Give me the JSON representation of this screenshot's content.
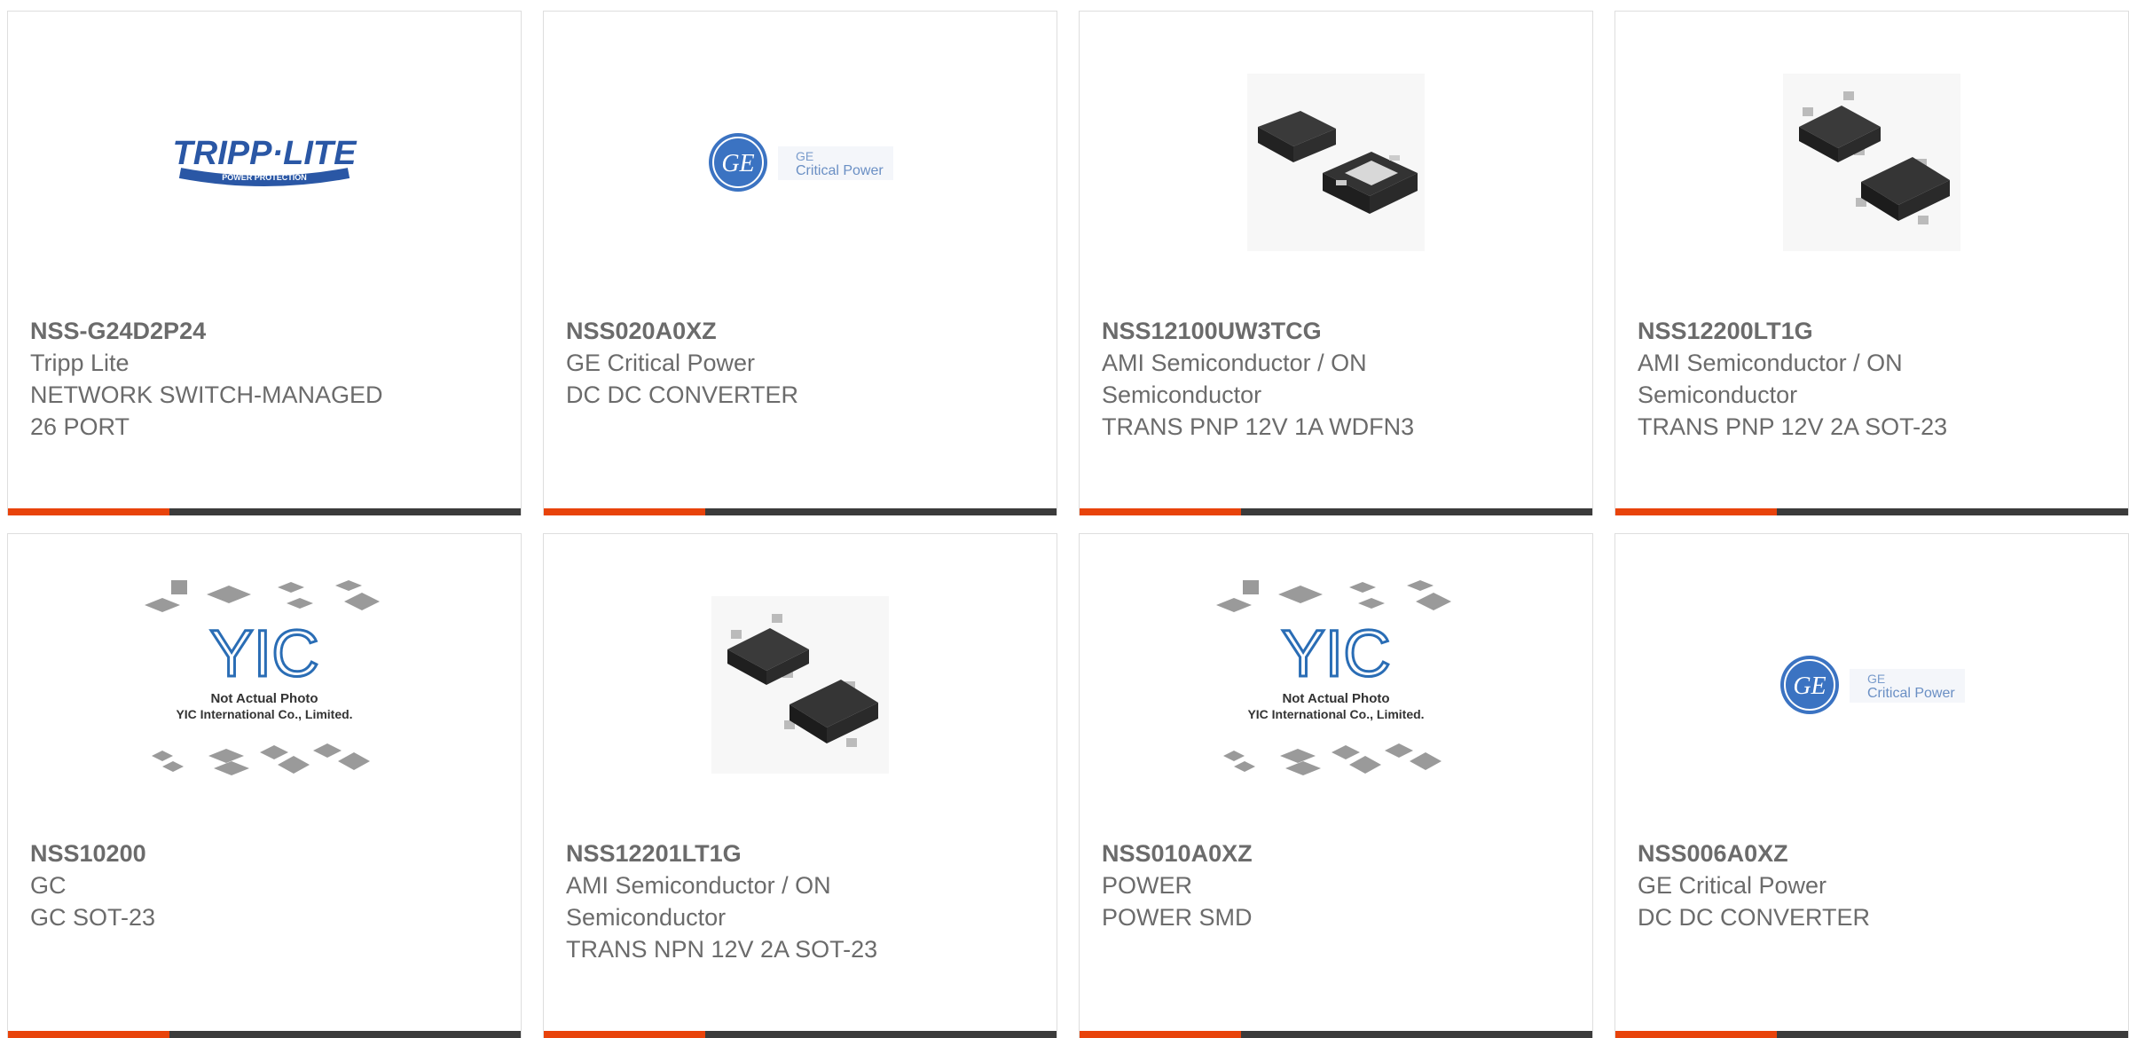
{
  "accent_color": "#e8430b",
  "products": [
    {
      "part": "NSS-G24D2P24",
      "lines": [
        "Tripp Lite",
        "NETWORK SWITCH-MANAGED",
        "26 PORT"
      ],
      "image": "tripp-lite-logo",
      "logo_text": "TRIPP·LITE",
      "logo_sub": "POWER PROTECTION"
    },
    {
      "part": "NSS020A0XZ",
      "lines": [
        "GE Critical Power",
        "DC DC CONVERTER"
      ],
      "image": "ge-logo",
      "logo_text": "GE",
      "logo_sub": "Critical Power"
    },
    {
      "part": "NSS12100UW3TCG",
      "lines": [
        "AMI Semiconductor / ON",
        "Semiconductor",
        "TRANS PNP 12V 1A WDFN3"
      ],
      "image": "wdfn3-chip-photo"
    },
    {
      "part": "NSS12200LT1G",
      "lines": [
        "AMI Semiconductor / ON",
        "Semiconductor",
        "TRANS PNP 12V 2A SOT-23"
      ],
      "image": "sot23-chip-photo"
    },
    {
      "part": "NSS10200",
      "lines": [
        "GC",
        "GC SOT-23"
      ],
      "image": "yic-placeholder",
      "logo_text": "YIC",
      "logo_sub": "Not Actual Photo",
      "logo_sub2": "YIC International Co., Limited."
    },
    {
      "part": "NSS12201LT1G",
      "lines": [
        "AMI Semiconductor / ON",
        "Semiconductor",
        "TRANS NPN 12V 2A SOT-23"
      ],
      "image": "sot23-chip-photo"
    },
    {
      "part": "NSS010A0XZ",
      "lines": [
        "POWER",
        "POWER SMD"
      ],
      "image": "yic-placeholder",
      "logo_text": "YIC",
      "logo_sub": "Not Actual Photo",
      "logo_sub2": "YIC International Co., Limited."
    },
    {
      "part": "NSS006A0XZ",
      "lines": [
        "GE Critical Power",
        "DC DC CONVERTER"
      ],
      "image": "ge-logo",
      "logo_text": "GE",
      "logo_sub": "Critical Power"
    }
  ]
}
